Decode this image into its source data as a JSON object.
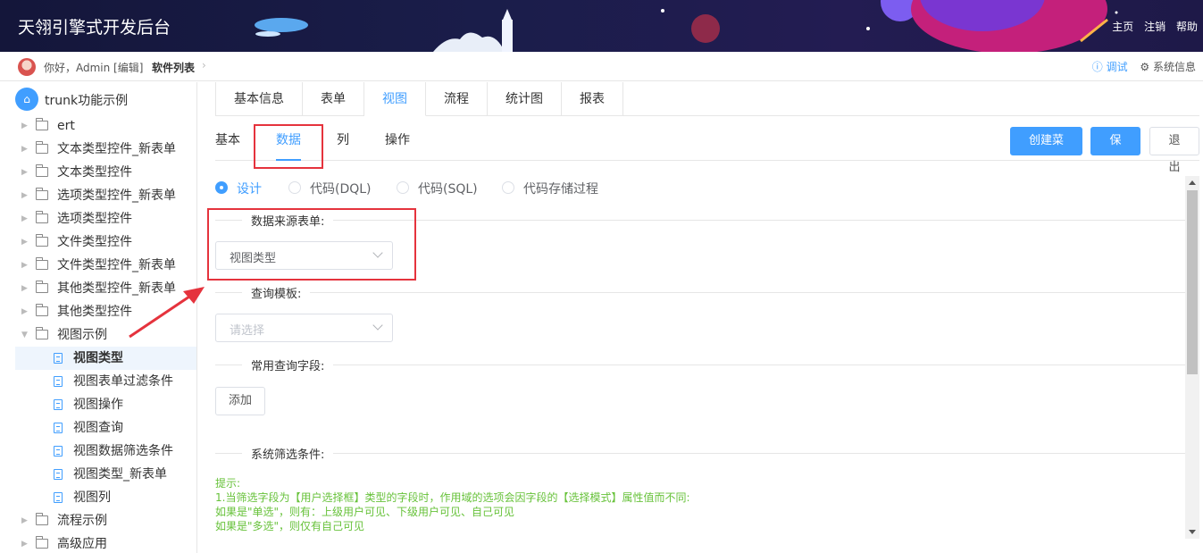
{
  "header": {
    "title": "天翎引擎式开发后台",
    "links": [
      "主页",
      "注销",
      "帮助"
    ]
  },
  "breadcrumb": {
    "greeting": "你好，Admin [编辑]",
    "current": "软件列表",
    "debug": "调试",
    "system_info": "系统信息"
  },
  "sidebar": {
    "root": "trunk功能示例",
    "items": [
      {
        "label": "ert"
      },
      {
        "label": "文本类型控件_新表单"
      },
      {
        "label": "文本类型控件"
      },
      {
        "label": "选项类型控件_新表单"
      },
      {
        "label": "选项类型控件"
      },
      {
        "label": "文件类型控件"
      },
      {
        "label": "文件类型控件_新表单"
      },
      {
        "label": "其他类型控件_新表单"
      },
      {
        "label": "其他类型控件"
      },
      {
        "label": "视图示例"
      }
    ],
    "children": [
      {
        "label": "视图类型"
      },
      {
        "label": "视图表单过滤条件"
      },
      {
        "label": "视图操作"
      },
      {
        "label": "视图查询"
      },
      {
        "label": "视图数据筛选条件"
      },
      {
        "label": "视图类型_新表单"
      },
      {
        "label": "视图列"
      }
    ],
    "tail": [
      {
        "label": "流程示例"
      },
      {
        "label": "高级应用"
      }
    ]
  },
  "main": {
    "top_tabs": [
      "基本信息",
      "表单",
      "视图",
      "流程",
      "统计图",
      "报表"
    ],
    "sub_tabs": [
      "基本",
      "数据",
      "列",
      "操作"
    ],
    "buttons": {
      "create_menu": "创建菜单",
      "save": "保存",
      "exit": "退出"
    },
    "radios": [
      "设计",
      "代码(DQL)",
      "代码(SQL)",
      "代码存储过程"
    ],
    "sections": {
      "data_source": "数据来源表单:",
      "query_template": "查询模板:",
      "common_fields": "常用查询字段:",
      "system_filter": "系统筛选条件:"
    },
    "data_source_value": "视图类型",
    "query_template_placeholder": "请选择",
    "add_button": "添加",
    "hint_lines": [
      "提示:",
      "1.当筛选字段为【用户选择框】类型的字段时，作用域的选项会因字段的【选择模式】属性值而不同:",
      "如果是\"单选\"，则有：上级用户可见、下级用户可见、自己可见",
      "如果是\"多选\"，则仅有自己可见"
    ]
  },
  "colors": {
    "accent": "#409eff",
    "annotation": "#e5333d",
    "hint": "#67c23a"
  }
}
